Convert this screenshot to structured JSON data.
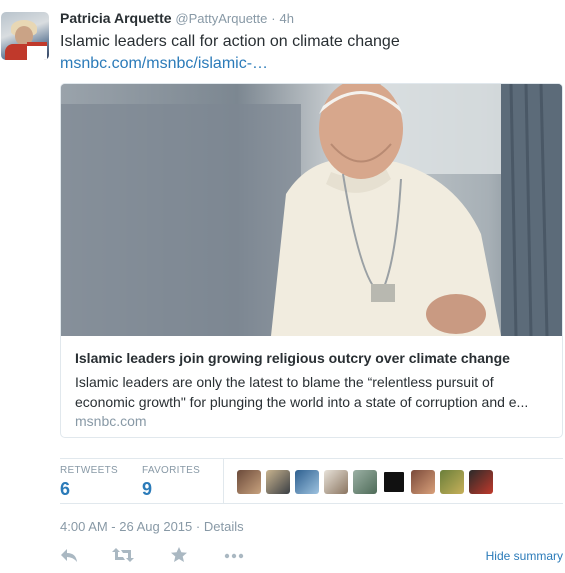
{
  "tweet": {
    "author_name": "Patricia Arquette",
    "author_handle": "@PattyArquette",
    "separator": "·",
    "time": "4h",
    "text": "Islamic leaders call for action on climate change",
    "link": "msnbc.com/msnbc/islamic-…"
  },
  "card": {
    "title": "Islamic leaders join growing religious outcry over climate change",
    "description_line1": "Islamic leaders are only the latest to blame the “relentless pursuit of",
    "description_line2": "economic growth\" for plunging the world into a state of corruption and e...",
    "domain": "msnbc.com"
  },
  "stats": {
    "retweets_label": "RETWEETS",
    "retweets_value": "6",
    "favorites_label": "FAVORITES",
    "favorites_value": "9",
    "favoriter_avatars": [
      "avatar-1",
      "avatar-2",
      "avatar-3",
      "avatar-4",
      "avatar-5",
      "avatar-6",
      "avatar-7",
      "avatar-8",
      "avatar-9"
    ]
  },
  "footer": {
    "timestamp": "4:00 AM - 26 Aug 2015",
    "separator": "·",
    "details": "Details",
    "hide_summary": "Hide summary"
  },
  "icons": {
    "reply": "reply-icon",
    "retweet": "retweet-icon",
    "favorite": "star-icon",
    "more": "more-icon"
  },
  "colors": {
    "link": "#2b7bb9",
    "muted": "#8899a6",
    "border": "#e1e8ed",
    "text": "#292f33"
  }
}
